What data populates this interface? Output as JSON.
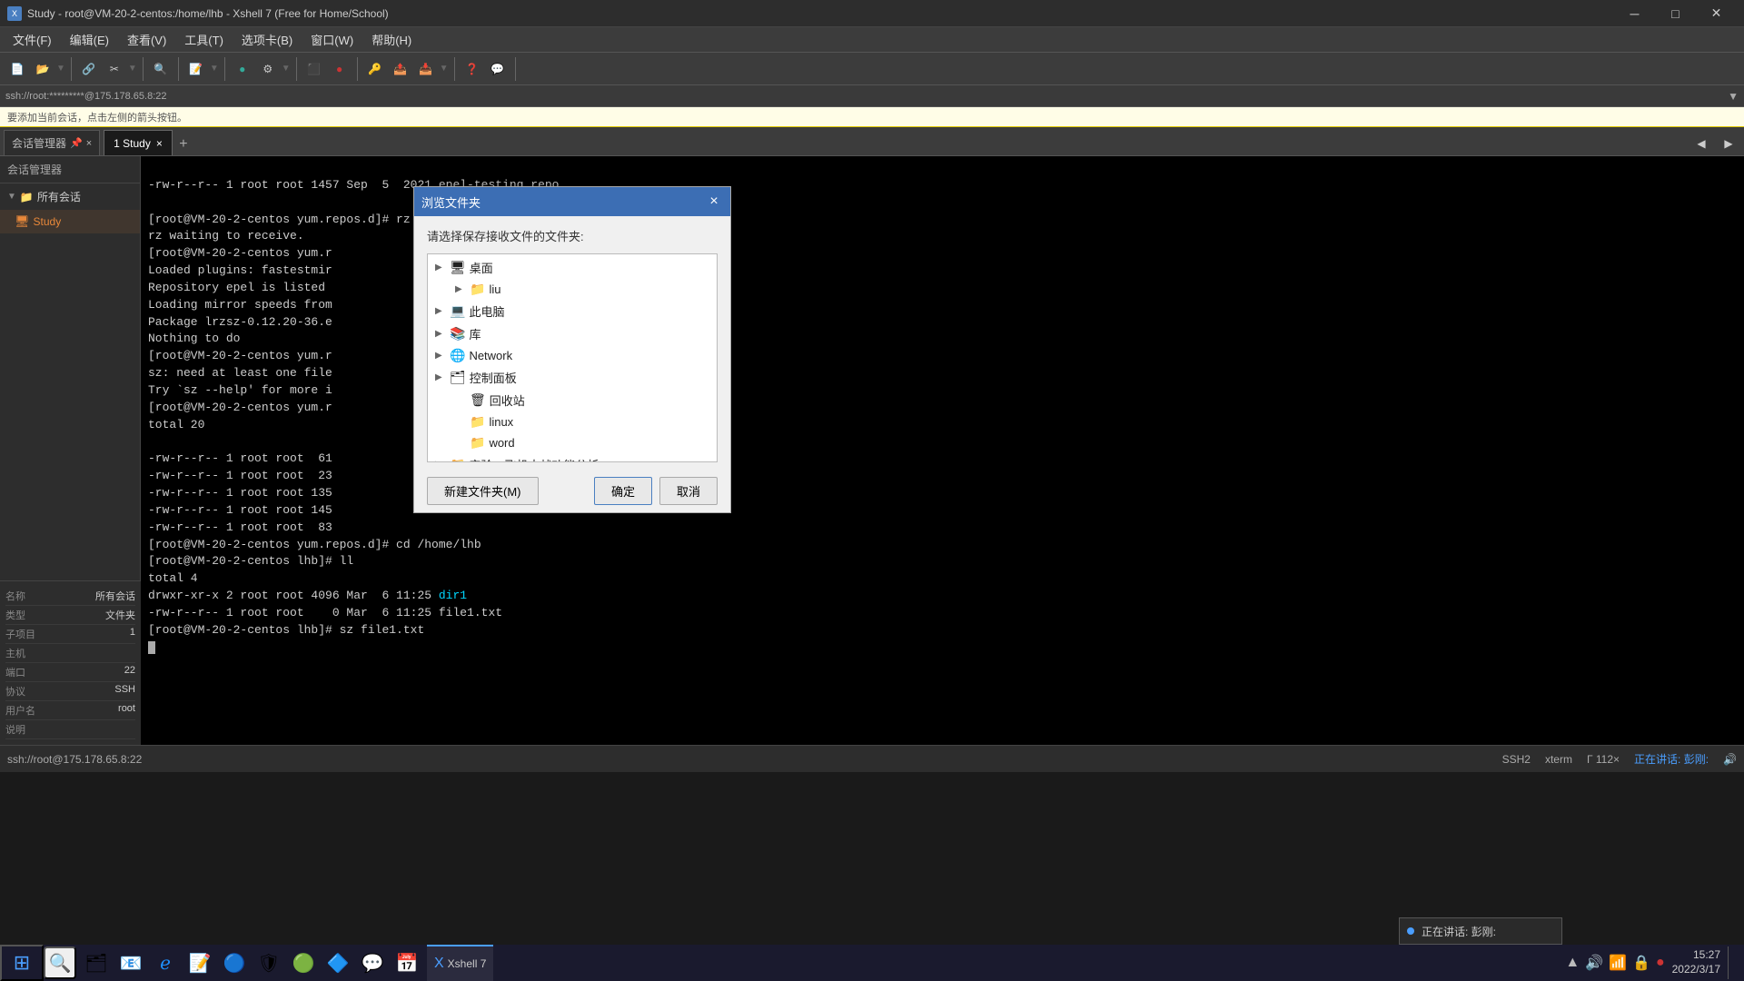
{
  "window": {
    "title": "Study - root@VM-20-2-centos:/home/lhb - Xshell 7 (Free for Home/School)",
    "icon": "X"
  },
  "menu": {
    "items": [
      "文件(F)",
      "编辑(E)",
      "查看(V)",
      "工具(T)",
      "选项卡(B)",
      "窗口(W)",
      "帮助(H)"
    ]
  },
  "ssh_bar": {
    "text": "ssh://root:*********@175.178.65.8:22",
    "arrow": "▼"
  },
  "notif_bar": {
    "text": "要添加当前会话，点击左侧的箭头按钮。"
  },
  "tabs": {
    "session_manager_label": "会话管理器",
    "active_tab": "1 Study",
    "add_tab": "+",
    "close_icons": [
      "□",
      "×"
    ]
  },
  "sidebar": {
    "header": "会话管理器",
    "all_sessions_label": "所有会话",
    "study_item_label": "Study"
  },
  "properties": {
    "rows": [
      {
        "label": "名称",
        "value": "所有会话"
      },
      {
        "label": "类型",
        "value": "文件夹"
      },
      {
        "label": "子项目",
        "value": "1"
      },
      {
        "label": "主机",
        "value": ""
      },
      {
        "label": "端口",
        "value": "22"
      },
      {
        "label": "协议",
        "value": "SSH"
      },
      {
        "label": "用户名",
        "value": "root"
      },
      {
        "label": "说明",
        "value": ""
      }
    ]
  },
  "terminal": {
    "lines": [
      "-rw-r--r-- 1 root root 1457 Sep  5  2021 epel-testing.repo",
      "[root@VM-20-2-centos yum.repos.d]# rz -E",
      "rz waiting to receive.",
      "[root@VM-20-2-centos yum.r",
      "Loaded plugins: fastestmir",
      "Repository epel is listed",
      "Loading mirror speeds from",
      "Package lrzsz-0.12.20-36.e",
      "Nothing to do",
      "[root@VM-20-2-centos yum.r",
      "sz: need at least one file",
      "Try `sz --help' for more i",
      "[root@VM-20-2-centos yum.r",
      "total 20",
      "",
      "-rw-r--r-- 1 root root  61",
      "-rw-r--r-- 1 root root  23",
      "-rw-r--r-- 1 root root 135",
      "-rw-r--r-- 1 root root 145",
      "-rw-r--r-- 1 root root  83",
      "[root@VM-20-2-centos yum.repos.d]# cd /home/lhb",
      "[root@VM-20-2-centos lhb]# ll",
      "total 4",
      "drwxr-xr-x 2 root root 4096 Mar  6 11:25 dir1",
      "-rw-r--r-- 1 root root    0 Mar  6 11:25 file1.txt",
      "[root@VM-20-2-centos lhb]# sz file1.txt",
      ""
    ],
    "dir1_label": "dir1",
    "file1_label": "file1.txt"
  },
  "status_bar": {
    "left": "ssh://root@175.178.65.8:22",
    "items": [
      "SSH2",
      "xterm",
      "Γ 112×",
      "正在讲话: 彭刚:"
    ]
  },
  "dialog": {
    "title": "浏览文件夹",
    "close_btn": "×",
    "instruction": "请选择保存接收文件的文件夹:",
    "tree_items": [
      {
        "label": "桌面",
        "indent": 0,
        "expanded": false,
        "type": "folder",
        "selected": false
      },
      {
        "label": "liu",
        "indent": 1,
        "expanded": false,
        "type": "folder",
        "selected": false
      },
      {
        "label": "此电脑",
        "indent": 0,
        "expanded": false,
        "type": "pc",
        "selected": false
      },
      {
        "label": "库",
        "indent": 0,
        "expanded": false,
        "type": "folder",
        "selected": false
      },
      {
        "label": "Network",
        "indent": 0,
        "expanded": false,
        "type": "network",
        "selected": false
      },
      {
        "label": "控制面板",
        "indent": 0,
        "expanded": false,
        "type": "controlpanel",
        "selected": false
      },
      {
        "label": "回收站",
        "indent": 1,
        "expanded": false,
        "type": "trash",
        "selected": false
      },
      {
        "label": "linux",
        "indent": 1,
        "expanded": false,
        "type": "folder",
        "selected": false
      },
      {
        "label": "word",
        "indent": 1,
        "expanded": false,
        "type": "folder",
        "selected": false
      },
      {
        "label": "实验一飞机大战功能分析",
        "indent": 0,
        "expanded": false,
        "type": "folder",
        "selected": false
      }
    ],
    "new_folder_btn": "新建文件夹(M)",
    "confirm_btn": "确定",
    "cancel_btn": "取消"
  },
  "taskbar": {
    "start_icon": "⊞",
    "search_icon": "🔍",
    "time": "15:27",
    "date": "2022/3/17",
    "active_app": "Xshell",
    "speaking_label": "正在讲话: 彭刚:",
    "taskbar_icons": [
      "🗂",
      "📧",
      "🌐",
      "📝",
      "🔵",
      "🔶",
      "🟢",
      "🔷",
      "📅"
    ],
    "notify_icons": [
      "▲",
      "🔊",
      "📶",
      "🔒",
      "📅"
    ]
  }
}
